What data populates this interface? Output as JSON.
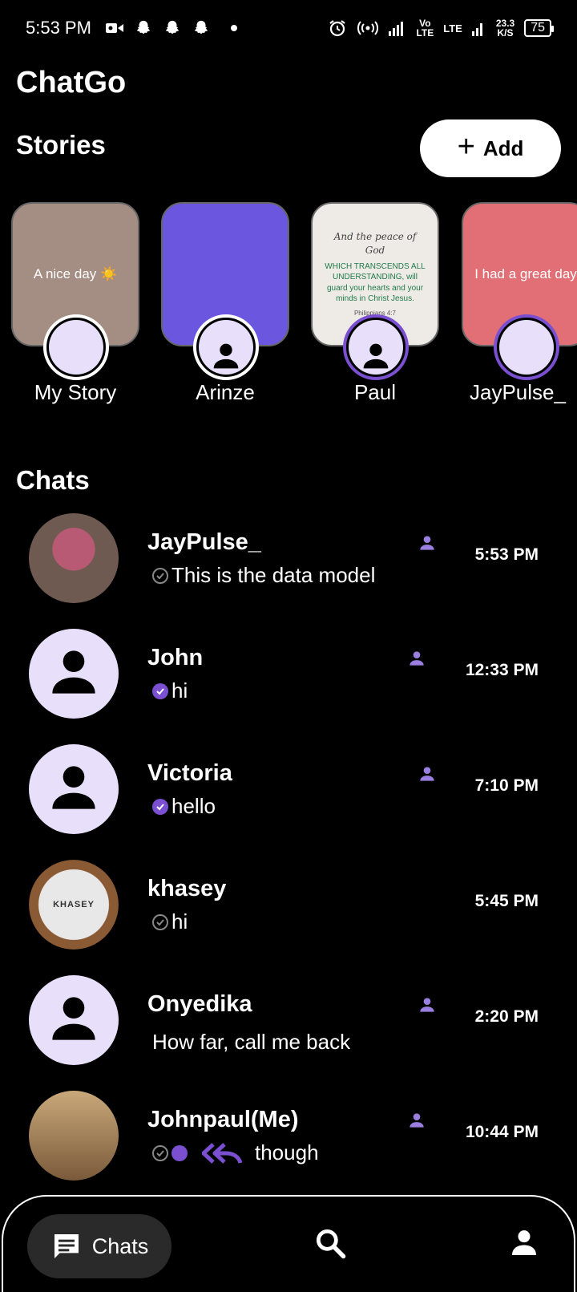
{
  "status_bar": {
    "time": "5:53 PM",
    "battery": "75",
    "speed_value": "23.3",
    "speed_unit": "K/S",
    "volte": "Vo",
    "volte_sub": "LTE",
    "lte": "LTE"
  },
  "app": {
    "title": "ChatGo"
  },
  "stories": {
    "title": "Stories",
    "add_label": "Add",
    "items": [
      {
        "name": "My Story",
        "text": "A nice day ☀️"
      },
      {
        "name": "Arinze",
        "text": ""
      },
      {
        "name": "Paul",
        "text": "",
        "quote_script": "And the peace of God",
        "quote_body": "WHICH TRANSCENDS ALL UNDERSTANDING, will guard your hearts and your minds in Christ Jesus.",
        "quote_ref": "Philippians 4:7"
      },
      {
        "name": "JayPulse_",
        "text": "I had a great day"
      }
    ]
  },
  "chats": {
    "title": "Chats",
    "items": [
      {
        "name": "JayPulse_",
        "message": "This is the data model",
        "time": "5:53 PM",
        "tick": "grey"
      },
      {
        "name": "John",
        "message": "hi",
        "time": "12:33 PM",
        "tick": "purple"
      },
      {
        "name": "Victoria",
        "message": "hello",
        "time": "7:10 PM",
        "tick": "purple"
      },
      {
        "name": "khasey",
        "message": "hi",
        "time": "5:45 PM",
        "tick": "grey",
        "avatar_text": "KHASEY"
      },
      {
        "name": "Onyedika",
        "message": "How far, call me back",
        "time": "2:20 PM",
        "tick": "none"
      },
      {
        "name": "Johnpaul(Me)",
        "message": "though",
        "time": "10:44 PM",
        "tick": "grey-dot"
      }
    ]
  },
  "bottom_nav": {
    "chats_label": "Chats",
    "icons": [
      "chat-icon",
      "search-icon",
      "profile-icon"
    ]
  },
  "colors": {
    "accent": "#7a4fd0",
    "avatar_bg": "#e8e0fb",
    "background": "#000000"
  }
}
